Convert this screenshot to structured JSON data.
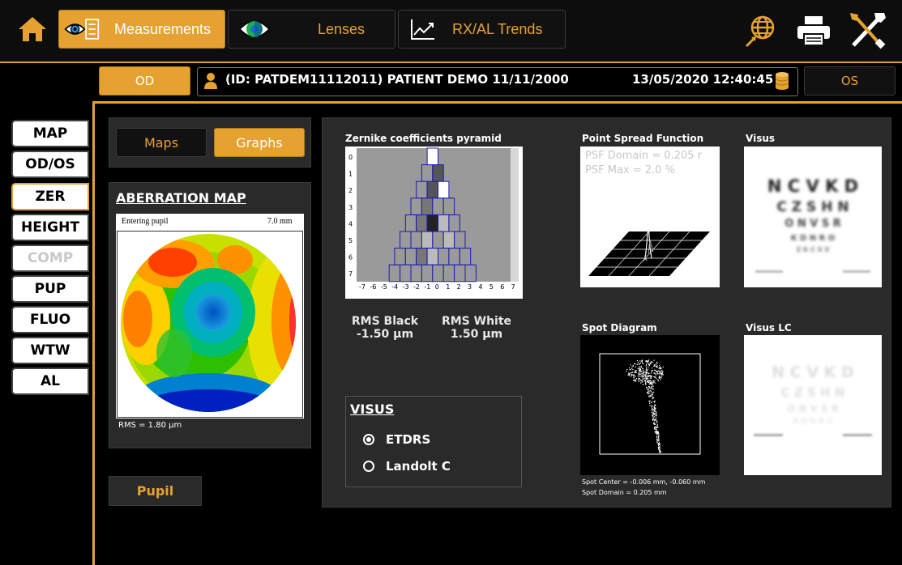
{
  "tabs": [
    {
      "label": "Measurements",
      "icon": "eye-measure-icon",
      "active": true
    },
    {
      "label": "Lenses",
      "icon": "eye-lens-icon",
      "active": false
    },
    {
      "label": "RX/AL Trends",
      "icon": "trend-chart-icon",
      "active": false
    }
  ],
  "eye_buttons": {
    "od": "OD",
    "os": "OS"
  },
  "patient": {
    "info": "(ID: PATDEM11112011) PATIENT DEMO 11/11/2000",
    "datetime": "13/05/2020 12:40:45"
  },
  "side_menu": [
    {
      "label": "MAP",
      "state": "normal"
    },
    {
      "label": "OD/OS",
      "state": "normal"
    },
    {
      "label": "ZER",
      "state": "active"
    },
    {
      "label": "HEIGHT",
      "state": "normal"
    },
    {
      "label": "COMP",
      "state": "disabled"
    },
    {
      "label": "PUP",
      "state": "normal"
    },
    {
      "label": "FLUO",
      "state": "normal"
    },
    {
      "label": "WTW",
      "state": "normal"
    },
    {
      "label": "AL",
      "state": "normal"
    }
  ],
  "view_toggle": {
    "maps": "Maps",
    "graphs": "Graphs",
    "selected": "Graphs"
  },
  "aberration": {
    "title": "ABERRATION MAP",
    "entering_pupil": "Entering pupil",
    "pupil_size": "7.0 mm",
    "rms": "RMS = 1.80 µm"
  },
  "pupil_button": "Pupil",
  "pyramid": {
    "title": "Zernike coefficients pyramid",
    "y_ticks": [
      "0",
      "1",
      "2",
      "3",
      "4",
      "5",
      "6",
      "7"
    ],
    "x_ticks": [
      "-7",
      "-6",
      "-5",
      "-4",
      "-3",
      "-2",
      "-1",
      "0",
      "1",
      "2",
      "3",
      "4",
      "5",
      "6",
      "7"
    ]
  },
  "rms_black": {
    "label": "RMS Black",
    "value": "-1.50 µm"
  },
  "rms_white": {
    "label": "RMS White",
    "value": "1.50 µm"
  },
  "visus_box": {
    "title": "VISUS",
    "options": [
      {
        "label": "ETDRS",
        "selected": true
      },
      {
        "label": "Landolt C",
        "selected": false
      }
    ]
  },
  "psf": {
    "title": "Point Spread Function",
    "domain": "PSF Domain = 0.205 r",
    "max": "PSF Max = 2.0 %"
  },
  "visus": {
    "title": "Visus",
    "rows": [
      "N C V K D",
      "C Z S H N",
      "O N V S R",
      "K D N R O",
      "Z K C S V"
    ]
  },
  "spot": {
    "title": "Spot Diagram",
    "center": "Spot Center = -0.006 mm, -0.060 mm",
    "domain": "Spot Domain = 0.205 mm"
  },
  "visus_lc": {
    "title": "Visus LC",
    "rows": [
      "N C V K D",
      "C Z S H N",
      "O N V S R",
      "K D N R O"
    ]
  },
  "colors": {
    "accent": "#e6a231",
    "panel": "#2a2a2a",
    "background": "#000000"
  }
}
